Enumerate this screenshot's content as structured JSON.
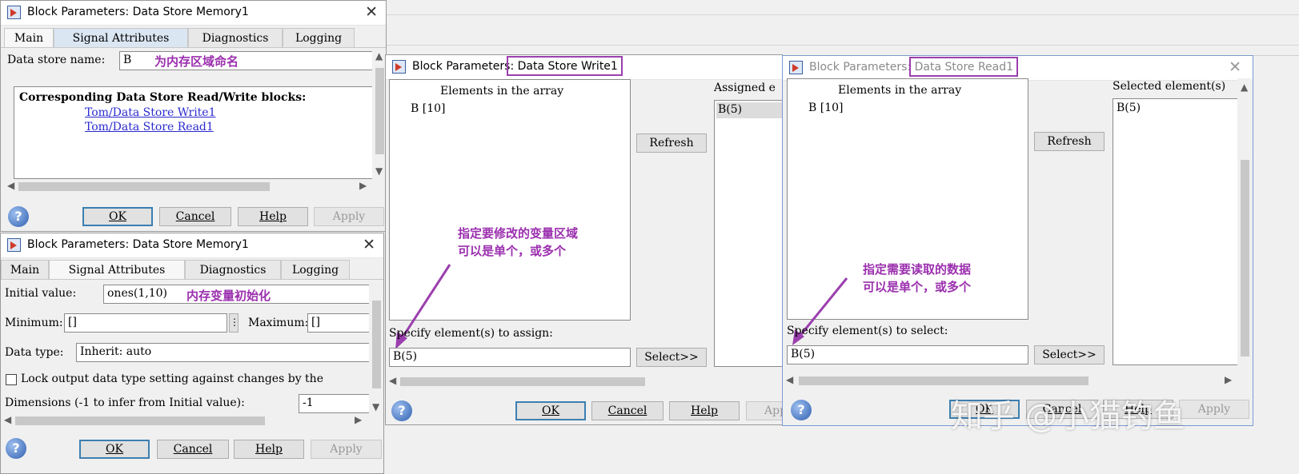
{
  "background": {
    "accent": "#9b2fae"
  },
  "dlg1": {
    "title": "Block Parameters: Data Store Memory1",
    "tabs": [
      "Main",
      "Signal Attributes",
      "Diagnostics",
      "Logging"
    ],
    "data_store_label": "Data store name:",
    "data_store_value": "B",
    "annotation": "为内存区域命名",
    "corr_header": "Corresponding Data Store Read/Write blocks:",
    "links": [
      "Tom/Data Store Write1",
      "Tom/Data Store Read1"
    ],
    "buttons": {
      "ok": "OK",
      "cancel": "Cancel",
      "help": "Help",
      "apply": "Apply"
    }
  },
  "dlg2": {
    "title": "Block Parameters: Data Store Memory1",
    "tabs": [
      "Main",
      "Signal Attributes",
      "Diagnostics",
      "Logging"
    ],
    "initial_label": "Initial value:",
    "initial_value": "ones(1,10)",
    "annotation": "内存变量初始化",
    "minimum_label": "Minimum:",
    "minimum_value": "[]",
    "maximum_label": "Maximum:",
    "maximum_value": "[]",
    "datatype_label": "Data type:",
    "datatype_value": "Inherit: auto",
    "lock_label": "Lock output data type setting against changes by the",
    "dimensions_label": "Dimensions (-1 to infer from Initial value):",
    "dimensions_value": "-1",
    "buttons": {
      "ok": "OK",
      "cancel": "Cancel",
      "help": "Help",
      "apply": "Apply"
    }
  },
  "dlg3": {
    "title_prefix": "Block Parameters: ",
    "title_name": "Data Store Write1",
    "elements_header": "Elements in the array",
    "elements": [
      "B [10]"
    ],
    "assigned_header": "Assigned e",
    "assigned": [
      "B(5)"
    ],
    "refresh": "Refresh",
    "annotation_line1": "指定要修改的变量区域",
    "annotation_line2": "可以是单个，或多个",
    "specify_label": "Specify element(s) to assign:",
    "specify_value": "B(5)",
    "select": "Select>>",
    "buttons": {
      "ok": "OK",
      "cancel": "Cancel",
      "help": "Help",
      "apply": "App"
    }
  },
  "dlg4": {
    "title_prefix": "Block Parameters: ",
    "title_name": "Data Store Read1",
    "elements_header": "Elements in the array",
    "elements": [
      "B [10]"
    ],
    "selected_header": "Selected element(s)",
    "selected": [
      "B(5)"
    ],
    "refresh": "Refresh",
    "annotation_line1": "指定需要读取的数据",
    "annotation_line2": "可以是单个，或多个",
    "specify_label": "Specify element(s) to select:",
    "specify_value": "B(5)",
    "select": "Select>>",
    "buttons": {
      "ok": "OK",
      "cancel": "Cancel",
      "help": "Help",
      "apply": "Apply"
    }
  },
  "watermark": "知乎 @小猫钓鱼"
}
